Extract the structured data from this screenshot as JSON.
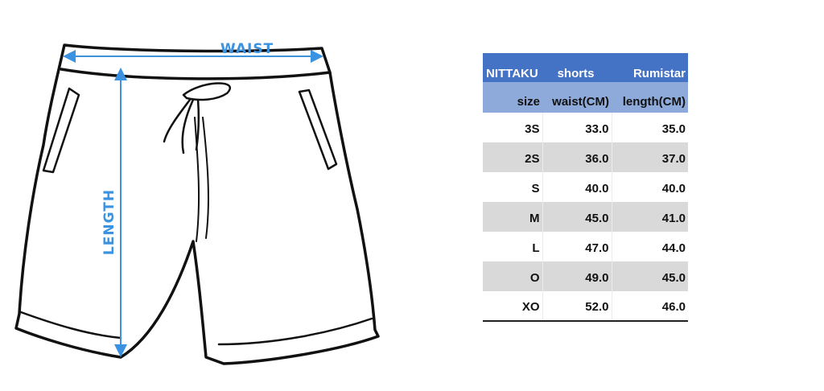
{
  "illustration": {
    "waist_label": "WAIST",
    "length_label": "LENGTH",
    "accent_color": "#3a92e0"
  },
  "table": {
    "brand": "NITTAKU",
    "product": "shorts",
    "brand2": "Rumistar",
    "headers": [
      "size",
      "waist(CM)",
      "length(CM)"
    ],
    "rows": [
      {
        "size": "3S",
        "waist": "33.0",
        "length": "35.0"
      },
      {
        "size": "2S",
        "waist": "36.0",
        "length": "37.0"
      },
      {
        "size": "S",
        "waist": "40.0",
        "length": "40.0"
      },
      {
        "size": "M",
        "waist": "45.0",
        "length": "41.0"
      },
      {
        "size": "L",
        "waist": "47.0",
        "length": "44.0"
      },
      {
        "size": "O",
        "waist": "49.0",
        "length": "45.0"
      },
      {
        "size": "XO",
        "waist": "52.0",
        "length": "46.0"
      }
    ],
    "colors": {
      "brand_row": "#4472c4",
      "header_row": "#8eaadb",
      "band_row": "#d9d9d9"
    }
  }
}
